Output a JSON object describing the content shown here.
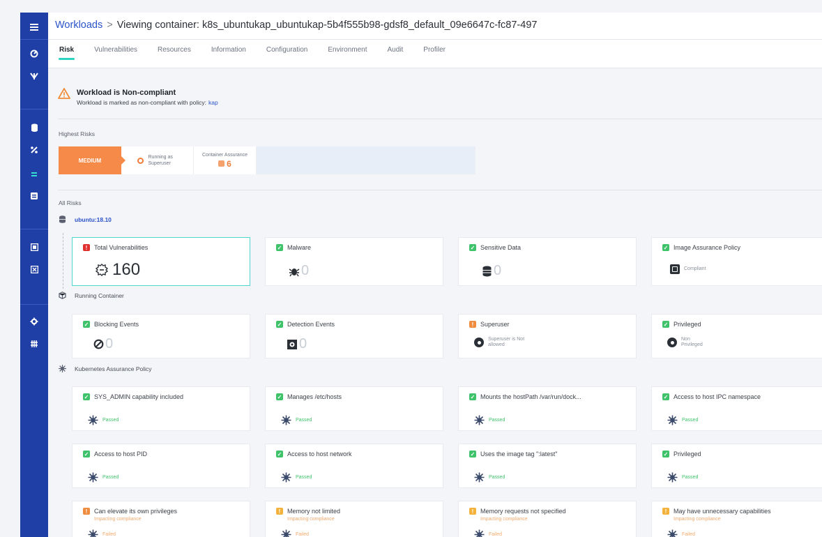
{
  "breadcrumb": {
    "root": "Workloads",
    "separator": ">",
    "current": "Viewing container: k8s_ubuntukap_ubuntukap-5b4f555b98-gdsf8_default_09e6647c-fc87-497"
  },
  "tabs": [
    "Risk",
    "Vulnerabilities",
    "Resources",
    "Information",
    "Configuration",
    "Environment",
    "Audit",
    "Profiler"
  ],
  "active_tab": "Risk",
  "sidebar_icons": [
    "menu-icon",
    "dashboard-icon",
    "shield-icon",
    "database-icon",
    "percent-icon",
    "container-icon",
    "list-icon",
    "report-icon",
    "registry-icon",
    "settings-icon",
    "integrations-icon"
  ],
  "alert": {
    "title": "Workload is Non-compliant",
    "description": "Workload is marked as non-compliant with policy:",
    "policy": "kap"
  },
  "highest_risks": {
    "label": "Highest Risks",
    "level": "MEDIUM",
    "running_as": "Running as Superuser",
    "assurance_label": "Container Assurance",
    "assurance_value": "6"
  },
  "all_risks_label": "All Risks",
  "image_group": {
    "label": "ubuntu:18.10",
    "cards": [
      {
        "title": "Total Vulnerabilities",
        "value": "160"
      },
      {
        "title": "Malware",
        "value": "0"
      },
      {
        "title": "Sensitive Data",
        "value": "0"
      },
      {
        "title": "Image Assurance Policy",
        "value": "Compliant"
      }
    ]
  },
  "container_group": {
    "label": "Running Container",
    "cards": [
      {
        "title": "Blocking Events",
        "value": "0"
      },
      {
        "title": "Detection Events",
        "value": "0"
      },
      {
        "title": "Superuser",
        "value": "Superuser is Not allowed"
      },
      {
        "title": "Privileged",
        "value": "Non Privileged"
      }
    ]
  },
  "k8s_group": {
    "label": "Kubernetes Assurance Policy",
    "cards": [
      {
        "title": "SYS_ADMIN capability included",
        "status": "Passed"
      },
      {
        "title": "Manages /etc/hosts",
        "status": "Passed"
      },
      {
        "title": "Mounts the hostPath /var/run/dock...",
        "status": "Passed"
      },
      {
        "title": "Access to host IPC namespace",
        "status": "Passed"
      },
      {
        "title": "Access to host PID",
        "status": "Passed"
      },
      {
        "title": "Access to host network",
        "status": "Passed"
      },
      {
        "title": "Uses the image tag \":latest\"",
        "status": "Passed"
      },
      {
        "title": "Privileged",
        "status": "Passed"
      },
      {
        "title": "Can elevate its own privileges",
        "subtitle": "Impacting compliance",
        "status": "Failed"
      },
      {
        "title": "Memory not limited",
        "subtitle": "Impacting compliance",
        "status": "Failed"
      },
      {
        "title": "Memory requests not specified",
        "subtitle": "Impacting compliance",
        "status": "Failed"
      },
      {
        "title": "May have unnecessary capabilities",
        "subtitle": "Impacting compliance",
        "status": "Failed"
      }
    ]
  },
  "colors": {
    "sidebar": "#1f3fa6",
    "accent": "#2ed3c2",
    "medium": "#f58a49",
    "passed": "#3ec36a",
    "critical": "#e0312f",
    "warning": "#f2b23c"
  }
}
